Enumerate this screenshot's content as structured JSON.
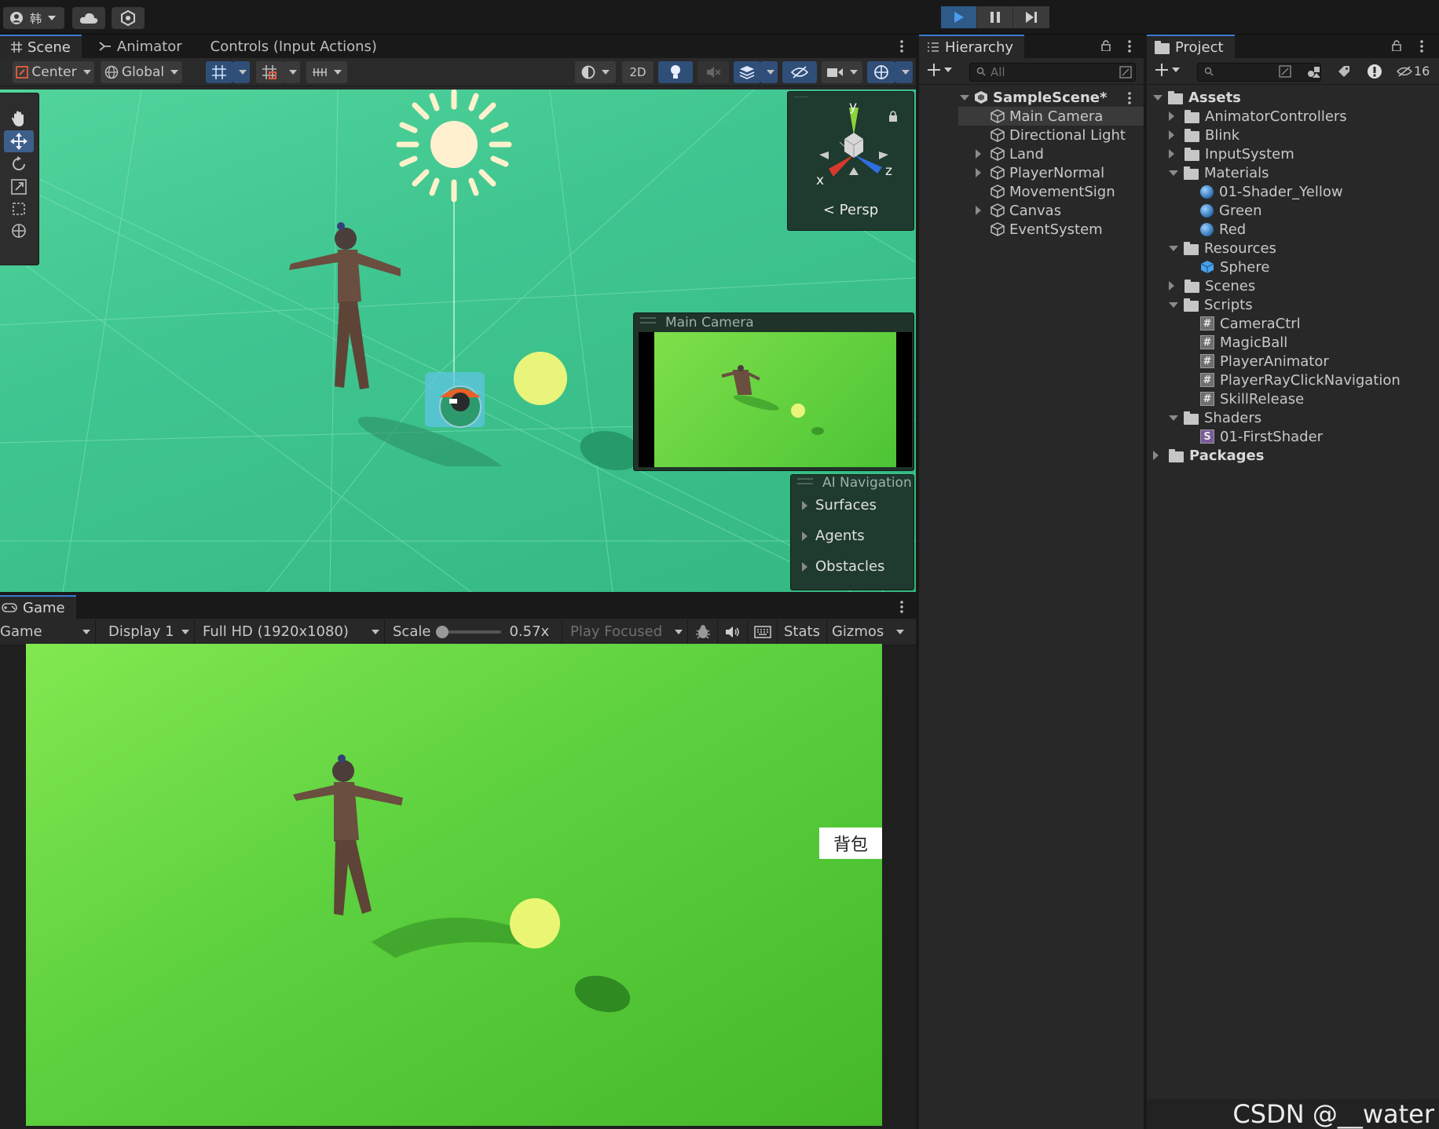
{
  "topbar": {
    "account_label": "韩",
    "play_state": "playing"
  },
  "scene_panel": {
    "tabs": [
      "Scene",
      "Animator",
      "Controls (Input Actions)"
    ],
    "toolbar": {
      "pivot": "Center",
      "space": "Global",
      "mode_2d": "2D"
    },
    "gizmo": {
      "x": "x",
      "y": "y",
      "z": "z",
      "projection": "Persp"
    },
    "camera_preview": {
      "title": "Main Camera"
    },
    "ai_navigation": {
      "title": "AI Navigation",
      "items": [
        "Surfaces",
        "Agents",
        "Obstacles"
      ]
    }
  },
  "game_panel": {
    "tab": "Game",
    "toolbar": {
      "view": "Game",
      "display": "Display 1",
      "resolution": "Full HD (1920x1080)",
      "scale_label": "Scale",
      "scale_value": "0.57x",
      "play_mode": "Play Focused",
      "stats": "Stats",
      "gizmos": "Gizmos"
    },
    "backpack_button": "背包"
  },
  "hierarchy": {
    "title": "Hierarchy",
    "search_placeholder": "All",
    "scene": "SampleScene*",
    "items": [
      {
        "label": "Main Camera",
        "expandable": false,
        "selected": true
      },
      {
        "label": "Directional Light",
        "expandable": false
      },
      {
        "label": "Land",
        "expandable": true
      },
      {
        "label": "PlayerNormal",
        "expandable": true
      },
      {
        "label": "MovementSign",
        "expandable": false
      },
      {
        "label": "Canvas",
        "expandable": true
      },
      {
        "label": "EventSystem",
        "expandable": false
      }
    ]
  },
  "project": {
    "title": "Project",
    "hidden_count": "16",
    "tree": [
      {
        "label": "Assets",
        "depth": 0,
        "type": "folder",
        "state": "open",
        "bold": true
      },
      {
        "label": "AnimatorControllers",
        "depth": 1,
        "type": "folder",
        "state": "closed"
      },
      {
        "label": "Blink",
        "depth": 1,
        "type": "folder",
        "state": "closed"
      },
      {
        "label": "InputSystem",
        "depth": 1,
        "type": "folder",
        "state": "closed"
      },
      {
        "label": "Materials",
        "depth": 1,
        "type": "folder",
        "state": "open"
      },
      {
        "label": "01-Shader_Yellow",
        "depth": 2,
        "type": "material"
      },
      {
        "label": "Green",
        "depth": 2,
        "type": "material"
      },
      {
        "label": "Red",
        "depth": 2,
        "type": "material"
      },
      {
        "label": "Resources",
        "depth": 1,
        "type": "folder",
        "state": "open"
      },
      {
        "label": "Sphere",
        "depth": 2,
        "type": "prefab"
      },
      {
        "label": "Scenes",
        "depth": 1,
        "type": "folder",
        "state": "closed"
      },
      {
        "label": "Scripts",
        "depth": 1,
        "type": "folder",
        "state": "open"
      },
      {
        "label": "CameraCtrl",
        "depth": 2,
        "type": "script"
      },
      {
        "label": "MagicBall",
        "depth": 2,
        "type": "script"
      },
      {
        "label": "PlayerAnimator",
        "depth": 2,
        "type": "script"
      },
      {
        "label": "PlayerRayClickNavigation",
        "depth": 2,
        "type": "script"
      },
      {
        "label": "SkillRelease",
        "depth": 2,
        "type": "script"
      },
      {
        "label": "Shaders",
        "depth": 1,
        "type": "folder",
        "state": "open"
      },
      {
        "label": "01-FirstShader",
        "depth": 2,
        "type": "shader"
      },
      {
        "label": "Packages",
        "depth": 0,
        "type": "folder",
        "state": "closed",
        "bold": true
      }
    ]
  },
  "watermark": "CSDN @__water"
}
